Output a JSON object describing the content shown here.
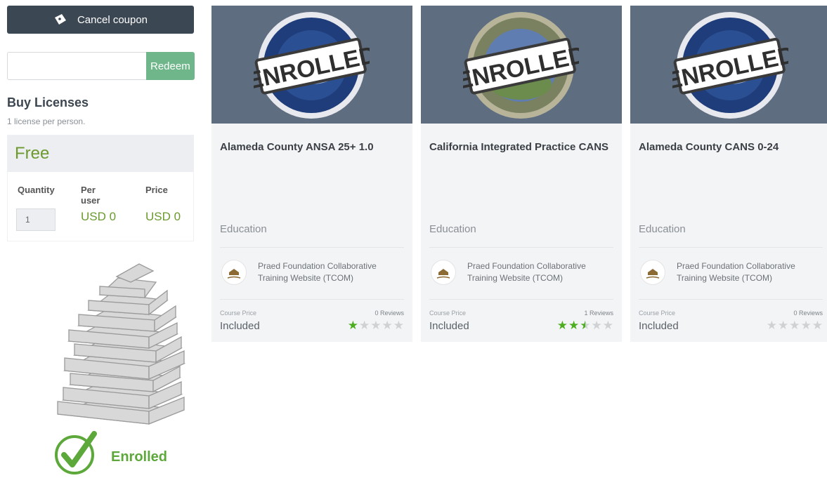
{
  "sidebar": {
    "cancel_coupon_label": "Cancel coupon",
    "coupon_placeholder": "",
    "redeem_label": "Redeem",
    "buy_title": "Buy Licenses",
    "buy_subtitle": "1 license per person.",
    "price_banner": "Free",
    "table_headers": {
      "quantity": "Quantity",
      "per_user": "Per user",
      "price": "Price"
    },
    "quantity_value": "1",
    "per_user_value": "USD 0",
    "price_value": "USD 0",
    "enrolled_label": "Enrolled"
  },
  "courses": [
    {
      "title": "Alameda County ANSA 25+ 1.0",
      "stamp": "ENROLLED",
      "category": "Education",
      "publisher": "Praed Foundation Collaborative Training Website (TCOM)",
      "price_label": "Course Price",
      "price": "Included",
      "reviews": "0 Reviews",
      "rating": 1
    },
    {
      "title": "California Integrated Practice CANS",
      "stamp": "ENROLLED",
      "category": "Education",
      "publisher": "Praed Foundation Collaborative Training Website (TCOM)",
      "price_label": "Course Price",
      "price": "Included",
      "reviews": "1 Reviews",
      "rating": 2.5
    },
    {
      "title": "Alameda County CANS 0-24",
      "stamp": "ENROLLED",
      "category": "Education",
      "publisher": "Praed Foundation Collaborative Training Website (TCOM)",
      "price_label": "Course Price",
      "price": "Included",
      "reviews": "0 Reviews",
      "rating": 0
    }
  ],
  "colors": {
    "accent_green": "#6c9a2e",
    "redeem_green": "#6fb68a",
    "star_green": "#4cae1f",
    "dark_button": "#3b4752",
    "card_image_bg": "#5f6d80"
  }
}
